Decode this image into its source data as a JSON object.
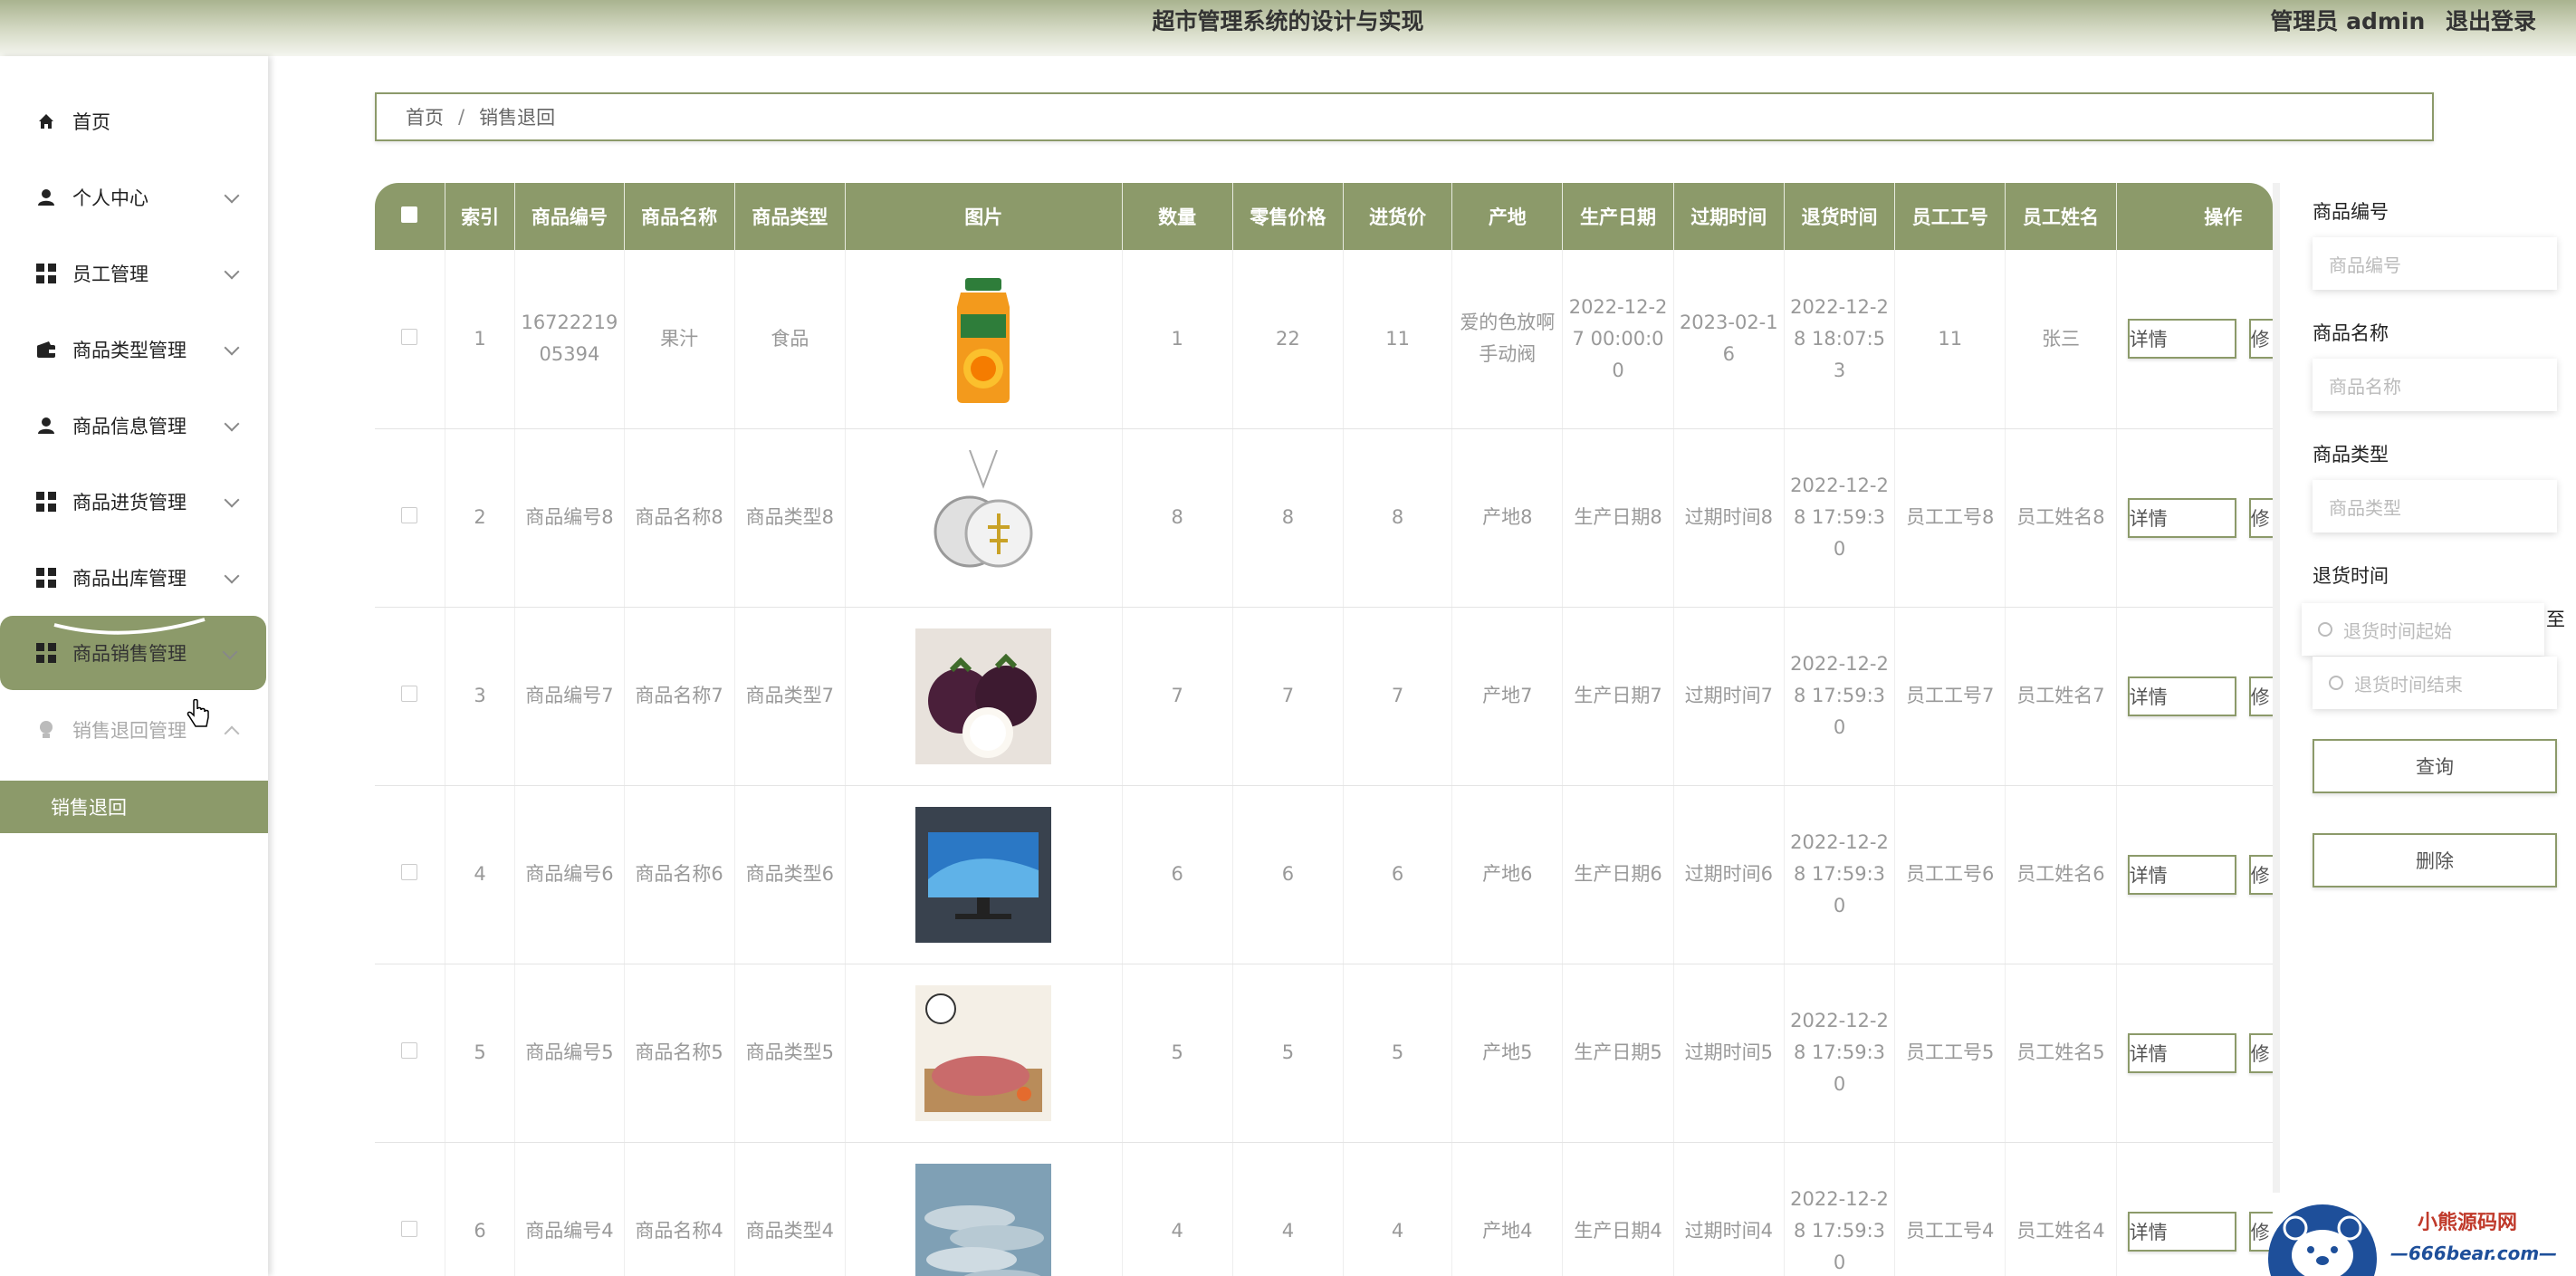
{
  "header": {
    "title": "超市管理系统的设计与实现",
    "user": "管理员 admin",
    "logout": "退出登录"
  },
  "sidebar": {
    "items": [
      {
        "label": "首页",
        "icon": "home-icon"
      },
      {
        "label": "个人中心",
        "icon": "person-icon"
      },
      {
        "label": "员工管理",
        "icon": "grid-icon"
      },
      {
        "label": "商品类型管理",
        "icon": "wallet-icon"
      },
      {
        "label": "商品信息管理",
        "icon": "person-icon"
      },
      {
        "label": "商品进货管理",
        "icon": "grid-icon"
      },
      {
        "label": "商品出库管理",
        "icon": "grid-icon"
      },
      {
        "label": "商品销售管理",
        "icon": "grid-icon"
      },
      {
        "label": "销售退回管理",
        "icon": "bulb-icon"
      }
    ],
    "submenu": {
      "label": "销售退回"
    }
  },
  "breadcrumb": {
    "home": "首页",
    "sep": "/",
    "current": "销售退回"
  },
  "table": {
    "headers": [
      "索引",
      "商品编号",
      "商品名称",
      "商品类型",
      "图片",
      "数量",
      "零售价格",
      "进货价",
      "产地",
      "生产日期",
      "过期时间",
      "退货时间",
      "员工工号",
      "员工姓名",
      "操作"
    ],
    "rows": [
      {
        "idx": "1",
        "code": "1672221905394",
        "name": "果汁",
        "type": "食品",
        "image": "juice-bottle",
        "qty": "1",
        "retail": "22",
        "cost": "11",
        "origin": "爱的色放啊手动阀",
        "produced": "2022-12-27 00:00:00",
        "expire": "2023-02-16",
        "returned": "2022-12-28 18:07:53",
        "staff_no": "11",
        "staff_name": "张三"
      },
      {
        "idx": "2",
        "code": "商品编号8",
        "name": "商品名称8",
        "type": "商品类型8",
        "image": "pendant",
        "qty": "8",
        "retail": "8",
        "cost": "8",
        "origin": "产地8",
        "produced": "生产日期8",
        "expire": "过期时间8",
        "returned": "2022-12-28 17:59:30",
        "staff_no": "员工工号8",
        "staff_name": "员工姓名8"
      },
      {
        "idx": "3",
        "code": "商品编号7",
        "name": "商品名称7",
        "type": "商品类型7",
        "image": "mangosteen",
        "qty": "7",
        "retail": "7",
        "cost": "7",
        "origin": "产地7",
        "produced": "生产日期7",
        "expire": "过期时间7",
        "returned": "2022-12-28 17:59:30",
        "staff_no": "员工工号7",
        "staff_name": "员工姓名7"
      },
      {
        "idx": "4",
        "code": "商品编号6",
        "name": "商品名称6",
        "type": "商品类型6",
        "image": "monitor",
        "qty": "6",
        "retail": "6",
        "cost": "6",
        "origin": "产地6",
        "produced": "生产日期6",
        "expire": "过期时间6",
        "returned": "2022-12-28 17:59:30",
        "staff_no": "员工工号6",
        "staff_name": "员工姓名6"
      },
      {
        "idx": "5",
        "code": "商品编号5",
        "name": "商品名称5",
        "type": "商品类型5",
        "image": "pork",
        "qty": "5",
        "retail": "5",
        "cost": "5",
        "origin": "产地5",
        "produced": "生产日期5",
        "expire": "过期时间5",
        "returned": "2022-12-28 17:59:30",
        "staff_no": "员工工号5",
        "staff_name": "员工姓名5"
      },
      {
        "idx": "6",
        "code": "商品编号4",
        "name": "商品名称4",
        "type": "商品类型4",
        "image": "fish",
        "qty": "4",
        "retail": "4",
        "cost": "4",
        "origin": "产地4",
        "produced": "生产日期4",
        "expire": "过期时间4",
        "returned": "2022-12-28 17:59:30",
        "staff_no": "员工工号4",
        "staff_name": "员工姓名4"
      }
    ],
    "detail_label": "详情",
    "edit_label": "修"
  },
  "search": {
    "code_label": "商品编号",
    "code_placeholder": "商品编号",
    "name_label": "商品名称",
    "name_placeholder": "商品名称",
    "type_label": "商品类型",
    "type_placeholder": "商品类型",
    "date_label": "退货时间",
    "date_start": "退货时间起始",
    "date_to": "至",
    "date_end": "退货时间结束",
    "query_label": "查询",
    "delete_label": "删除"
  },
  "watermark": {
    "line1": "小熊源码网",
    "line2": "—666bear.com—"
  },
  "colors": {
    "accent": "#8c9a6a"
  }
}
